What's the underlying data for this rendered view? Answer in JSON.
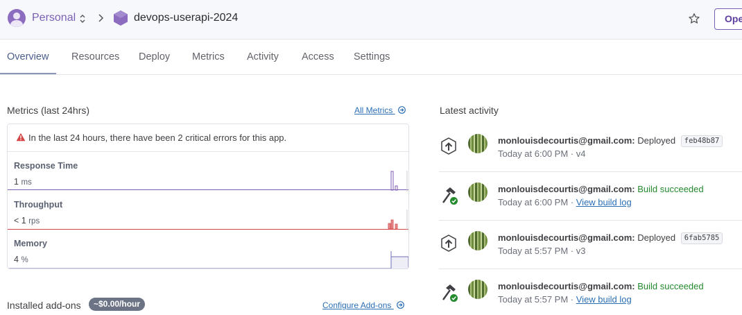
{
  "header": {
    "org": "Personal",
    "app_name": "devops-userapi-2024",
    "open_app_label": "Open app"
  },
  "tabs": [
    {
      "label": "Overview",
      "active": true
    },
    {
      "label": "Resources"
    },
    {
      "label": "Deploy"
    },
    {
      "label": "Metrics"
    },
    {
      "label": "Activity"
    },
    {
      "label": "Access"
    },
    {
      "label": "Settings"
    }
  ],
  "metrics": {
    "title": "Metrics (last 24hrs)",
    "all_metrics_link": "All Metrics",
    "alert": "In the last 24 hours, there have been 2 critical errors for this app.",
    "rows": [
      {
        "label": "Response Time",
        "value": "1",
        "unit": "ms",
        "color": "#7b5bb0"
      },
      {
        "label": "Throughput",
        "value": "< 1",
        "unit": "rps",
        "color": "#d64545"
      },
      {
        "label": "Memory",
        "value": "4",
        "unit": "%",
        "color": "#6f6fb8"
      }
    ]
  },
  "addons": {
    "title": "Installed add-ons",
    "cost_badge": "~$0.00/hour",
    "configure_link": "Configure Add-ons"
  },
  "activity": {
    "title": "Latest activity",
    "items": [
      {
        "icon": "deploy-upload-icon",
        "user": "monlouisdecourtis@gmail.com:",
        "action": "Deployed",
        "commit": "feb48b87",
        "time": "Today at 6:00 PM · v4"
      },
      {
        "icon": "build-hammer-icon",
        "user": "monlouisdecourtis@gmail.com:",
        "action": "Build succeeded",
        "time": "Today at 6:00 PM ·",
        "link": "View build log"
      },
      {
        "icon": "deploy-upload-icon",
        "user": "monlouisdecourtis@gmail.com:",
        "action": "Deployed",
        "commit": "6fab5785",
        "time": "Today at 5:57 PM · v3"
      },
      {
        "icon": "build-hammer-icon",
        "user": "monlouisdecourtis@gmail.com:",
        "action": "Build succeeded",
        "time": "Today at 5:57 PM ·",
        "link": "View build log"
      }
    ]
  },
  "colors": {
    "accent": "#7a5fb5",
    "link": "#2b6fb6",
    "success": "#248a2e",
    "error": "#d64545"
  }
}
